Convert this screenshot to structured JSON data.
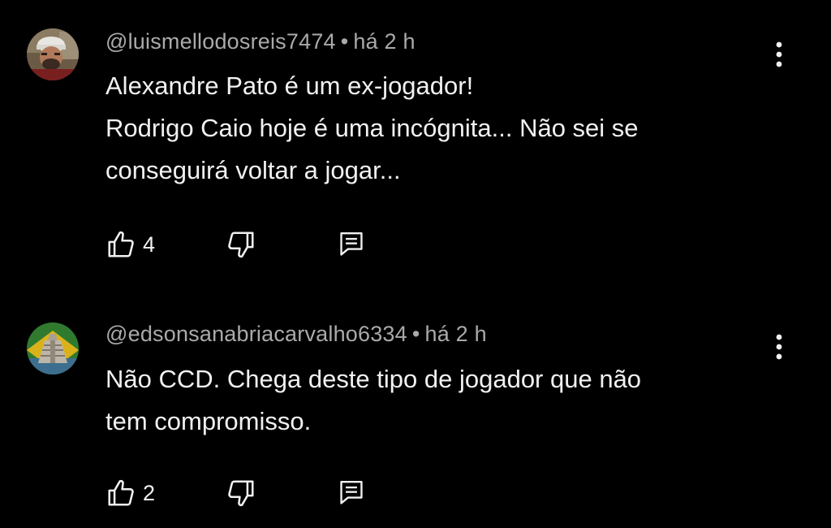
{
  "comments": [
    {
      "author": "@luismellodosreis7474",
      "separator": "•",
      "time": "há 2 h",
      "lines": [
        "Alexandre Pato é um ex-jogador!",
        "Rodrigo Caio hoje é uma incógnita... Não sei se",
        "conseguirá voltar a jogar..."
      ],
      "likes": "4",
      "avatar": "person-photo-avatar"
    },
    {
      "author": "@edsonsanabriacarvalho6334",
      "separator": "•",
      "time": "há 2 h",
      "lines": [
        "Não CCD. Chega deste tipo de jogador que não",
        "tem compromisso."
      ],
      "likes": "2",
      "avatar": "pyramid-avatar"
    }
  ],
  "icons": {
    "like": "thumbs-up-icon",
    "dislike": "thumbs-down-icon",
    "reply": "reply-comment-icon",
    "more": "more-vert-icon"
  },
  "colors": {
    "background": "#000000",
    "text": "#f1f1f1",
    "meta": "#aaaaaa"
  }
}
